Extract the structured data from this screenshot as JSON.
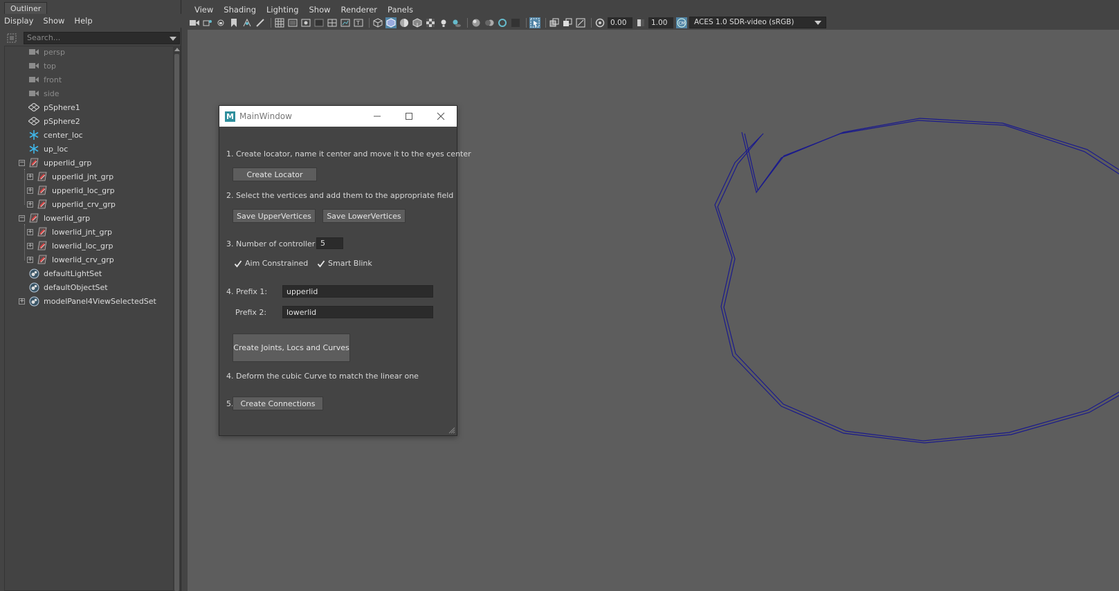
{
  "outliner": {
    "tab_title": "Outliner",
    "menu": [
      "Display",
      "Show",
      "Help"
    ],
    "search_placeholder": "Search...",
    "items": [
      {
        "label": "persp",
        "icon": "camera-icon"
      },
      {
        "label": "top",
        "icon": "camera-icon"
      },
      {
        "label": "front",
        "icon": "camera-icon"
      },
      {
        "label": "side",
        "icon": "camera-icon"
      },
      {
        "label": "pSphere1",
        "icon": "mesh-icon"
      },
      {
        "label": "pSphere2",
        "icon": "mesh-icon"
      },
      {
        "label": "center_loc",
        "icon": "locator-icon"
      },
      {
        "label": "up_loc",
        "icon": "locator-icon"
      },
      {
        "label": "upperlid_grp",
        "icon": "group-icon"
      },
      {
        "label": "upperlid_jnt_grp",
        "icon": "group-icon"
      },
      {
        "label": "upperlid_loc_grp",
        "icon": "group-icon"
      },
      {
        "label": "upperlid_crv_grp",
        "icon": "group-icon"
      },
      {
        "label": "lowerlid_grp",
        "icon": "group-icon"
      },
      {
        "label": "lowerlid_jnt_grp",
        "icon": "group-icon"
      },
      {
        "label": "lowerlid_loc_grp",
        "icon": "group-icon"
      },
      {
        "label": "lowerlid_crv_grp",
        "icon": "group-icon"
      },
      {
        "label": "defaultLightSet",
        "icon": "set-icon"
      },
      {
        "label": "defaultObjectSet",
        "icon": "set-icon"
      },
      {
        "label": "modelPanel4ViewSelectedSet",
        "icon": "set-icon"
      }
    ]
  },
  "viewport": {
    "menu": [
      "View",
      "Shading",
      "Lighting",
      "Show",
      "Renderer",
      "Panels"
    ],
    "exposure_value": "0.00",
    "gamma_value": "1.00",
    "color_space": "ACES 1.0 SDR-video (sRGB)",
    "curve_color": "#1a1a8c",
    "accent_color": "#5285a6"
  },
  "main_window": {
    "title": "MainWindow",
    "step1_text": "1. Create locator, name it center and move it to the eyes center",
    "create_locator_label": "Create Locator",
    "step2_text": "2. Select the vertices and add them to the appropriate field",
    "save_upper_label": "Save UpperVertices",
    "save_lower_label": "Save LowerVertices",
    "step3_text": "3. Number of controller",
    "controller_count": "5",
    "aim_constrained_label": "Aim Constrained",
    "aim_constrained_checked": true,
    "smart_blink_label": "Smart Blink",
    "smart_blink_checked": true,
    "prefix1_label": "4.  Prefix 1:",
    "prefix1_value": "upperlid",
    "prefix2_label": "Prefix 2:",
    "prefix2_value": "lowerlid",
    "create_joints_label": "Create Joints, Locs and Curves",
    "step4b_text": "4. Deform the cubic Curve to match the linear one",
    "step5_prefix": "5.",
    "create_connections_label": "Create Connections"
  }
}
